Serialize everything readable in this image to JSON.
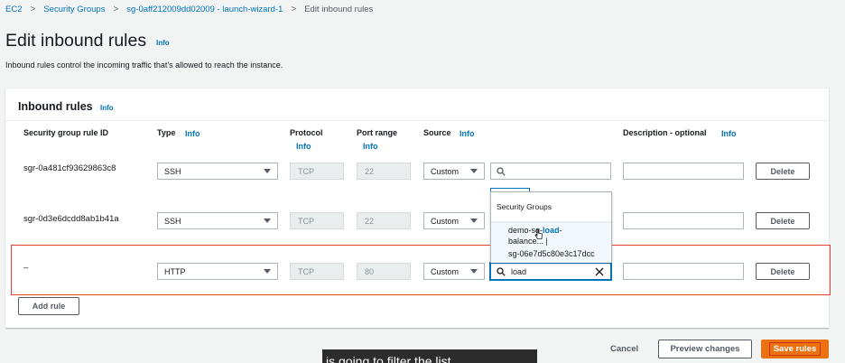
{
  "breadcrumb": {
    "items": [
      "EC2",
      "Security Groups",
      "sg-0aff212009dd02009 - launch-wizard-1",
      "Edit inbound rules"
    ],
    "separator": ">"
  },
  "page": {
    "title": "Edit inbound rules",
    "title_info": "Info",
    "description": "Inbound rules control the incoming traffic that's allowed to reach the instance."
  },
  "panel": {
    "title": "Inbound rules",
    "info": "Info",
    "columns": {
      "rule_id": "Security group rule ID",
      "type": "Type",
      "type_info": "Info",
      "protocol": "Protocol",
      "protocol_info": "Info",
      "port_range": "Port range",
      "port_range_info": "Info",
      "source": "Source",
      "source_info": "Info",
      "description": "Description - optional",
      "description_info": "Info"
    },
    "rows": [
      {
        "rule_id": "sgr-0a481cf93629863c8",
        "type": "SSH",
        "protocol": "TCP",
        "port": "22",
        "source": "Custom",
        "search_value": "",
        "delete": "Delete"
      },
      {
        "rule_id": "sgr-0d3e6dcdd8ab1b41a",
        "type": "SSH",
        "protocol": "TCP",
        "port": "22",
        "source": "Custom",
        "search_value": "",
        "delete": "Delete"
      },
      {
        "rule_id": "–",
        "type": "HTTP",
        "protocol": "TCP",
        "port": "80",
        "source": "Custom",
        "search_value": "load",
        "delete": "Delete"
      }
    ],
    "add_rule": "Add rule"
  },
  "dropdown": {
    "group_label": "Security Groups",
    "option_prefix": "demo-sg-",
    "option_match": "load",
    "option_suffix": "-",
    "option_line2": "balance... |",
    "option_id": "sg-06e7d5c80e3c17dcc"
  },
  "footer": {
    "cancel": "Cancel",
    "preview": "Preview changes",
    "save": "Save rules"
  },
  "caption": {
    "text": "is going to filter the list"
  },
  "colors": {
    "link": "#0073bb",
    "primary": "#ec7211",
    "highlight": "#e8432e"
  },
  "icons": [
    "chevron-right-icon",
    "search-icon",
    "close-icon",
    "caret-down-icon",
    "pointer-cursor-icon"
  ]
}
